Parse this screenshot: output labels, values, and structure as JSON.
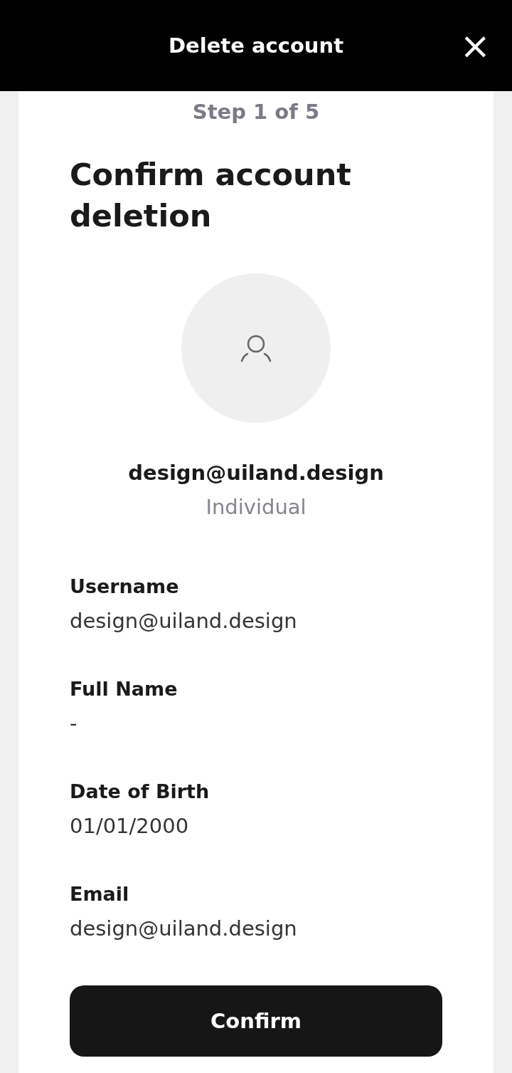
{
  "header": {
    "title": "Delete account",
    "close": "×"
  },
  "step": "Step 1 of 5",
  "heading": "Confirm account deletion",
  "profile": {
    "email": "design@uiland.design",
    "type": "Individual"
  },
  "fields": [
    {
      "label": "Username",
      "value": "design@uiland.design"
    },
    {
      "label": "Full Name",
      "value": "-"
    },
    {
      "label": "Date of Birth",
      "value": "01/01/2000"
    },
    {
      "label": "Email",
      "value": "design@uiland.design"
    }
  ],
  "button": "Confirm"
}
